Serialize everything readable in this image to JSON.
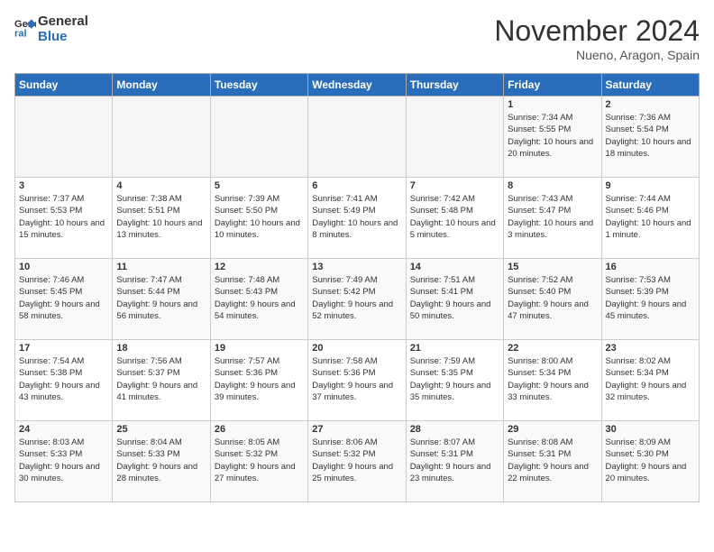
{
  "header": {
    "logo_general": "General",
    "logo_blue": "Blue",
    "month_title": "November 2024",
    "location": "Nueno, Aragon, Spain"
  },
  "weekdays": [
    "Sunday",
    "Monday",
    "Tuesday",
    "Wednesday",
    "Thursday",
    "Friday",
    "Saturday"
  ],
  "weeks": [
    [
      {
        "day": "",
        "empty": true
      },
      {
        "day": "",
        "empty": true
      },
      {
        "day": "",
        "empty": true
      },
      {
        "day": "",
        "empty": true
      },
      {
        "day": "",
        "empty": true
      },
      {
        "day": "1",
        "sunrise": "7:34 AM",
        "sunset": "5:55 PM",
        "daylight": "10 hours and 20 minutes."
      },
      {
        "day": "2",
        "sunrise": "7:36 AM",
        "sunset": "5:54 PM",
        "daylight": "10 hours and 18 minutes."
      }
    ],
    [
      {
        "day": "3",
        "sunrise": "7:37 AM",
        "sunset": "5:53 PM",
        "daylight": "10 hours and 15 minutes."
      },
      {
        "day": "4",
        "sunrise": "7:38 AM",
        "sunset": "5:51 PM",
        "daylight": "10 hours and 13 minutes."
      },
      {
        "day": "5",
        "sunrise": "7:39 AM",
        "sunset": "5:50 PM",
        "daylight": "10 hours and 10 minutes."
      },
      {
        "day": "6",
        "sunrise": "7:41 AM",
        "sunset": "5:49 PM",
        "daylight": "10 hours and 8 minutes."
      },
      {
        "day": "7",
        "sunrise": "7:42 AM",
        "sunset": "5:48 PM",
        "daylight": "10 hours and 5 minutes."
      },
      {
        "day": "8",
        "sunrise": "7:43 AM",
        "sunset": "5:47 PM",
        "daylight": "10 hours and 3 minutes."
      },
      {
        "day": "9",
        "sunrise": "7:44 AM",
        "sunset": "5:46 PM",
        "daylight": "10 hours and 1 minute."
      }
    ],
    [
      {
        "day": "10",
        "sunrise": "7:46 AM",
        "sunset": "5:45 PM",
        "daylight": "9 hours and 58 minutes."
      },
      {
        "day": "11",
        "sunrise": "7:47 AM",
        "sunset": "5:44 PM",
        "daylight": "9 hours and 56 minutes."
      },
      {
        "day": "12",
        "sunrise": "7:48 AM",
        "sunset": "5:43 PM",
        "daylight": "9 hours and 54 minutes."
      },
      {
        "day": "13",
        "sunrise": "7:49 AM",
        "sunset": "5:42 PM",
        "daylight": "9 hours and 52 minutes."
      },
      {
        "day": "14",
        "sunrise": "7:51 AM",
        "sunset": "5:41 PM",
        "daylight": "9 hours and 50 minutes."
      },
      {
        "day": "15",
        "sunrise": "7:52 AM",
        "sunset": "5:40 PM",
        "daylight": "9 hours and 47 minutes."
      },
      {
        "day": "16",
        "sunrise": "7:53 AM",
        "sunset": "5:39 PM",
        "daylight": "9 hours and 45 minutes."
      }
    ],
    [
      {
        "day": "17",
        "sunrise": "7:54 AM",
        "sunset": "5:38 PM",
        "daylight": "9 hours and 43 minutes."
      },
      {
        "day": "18",
        "sunrise": "7:56 AM",
        "sunset": "5:37 PM",
        "daylight": "9 hours and 41 minutes."
      },
      {
        "day": "19",
        "sunrise": "7:57 AM",
        "sunset": "5:36 PM",
        "daylight": "9 hours and 39 minutes."
      },
      {
        "day": "20",
        "sunrise": "7:58 AM",
        "sunset": "5:36 PM",
        "daylight": "9 hours and 37 minutes."
      },
      {
        "day": "21",
        "sunrise": "7:59 AM",
        "sunset": "5:35 PM",
        "daylight": "9 hours and 35 minutes."
      },
      {
        "day": "22",
        "sunrise": "8:00 AM",
        "sunset": "5:34 PM",
        "daylight": "9 hours and 33 minutes."
      },
      {
        "day": "23",
        "sunrise": "8:02 AM",
        "sunset": "5:34 PM",
        "daylight": "9 hours and 32 minutes."
      }
    ],
    [
      {
        "day": "24",
        "sunrise": "8:03 AM",
        "sunset": "5:33 PM",
        "daylight": "9 hours and 30 minutes."
      },
      {
        "day": "25",
        "sunrise": "8:04 AM",
        "sunset": "5:33 PM",
        "daylight": "9 hours and 28 minutes."
      },
      {
        "day": "26",
        "sunrise": "8:05 AM",
        "sunset": "5:32 PM",
        "daylight": "9 hours and 27 minutes."
      },
      {
        "day": "27",
        "sunrise": "8:06 AM",
        "sunset": "5:32 PM",
        "daylight": "9 hours and 25 minutes."
      },
      {
        "day": "28",
        "sunrise": "8:07 AM",
        "sunset": "5:31 PM",
        "daylight": "9 hours and 23 minutes."
      },
      {
        "day": "29",
        "sunrise": "8:08 AM",
        "sunset": "5:31 PM",
        "daylight": "9 hours and 22 minutes."
      },
      {
        "day": "30",
        "sunrise": "8:09 AM",
        "sunset": "5:30 PM",
        "daylight": "9 hours and 20 minutes."
      }
    ]
  ]
}
